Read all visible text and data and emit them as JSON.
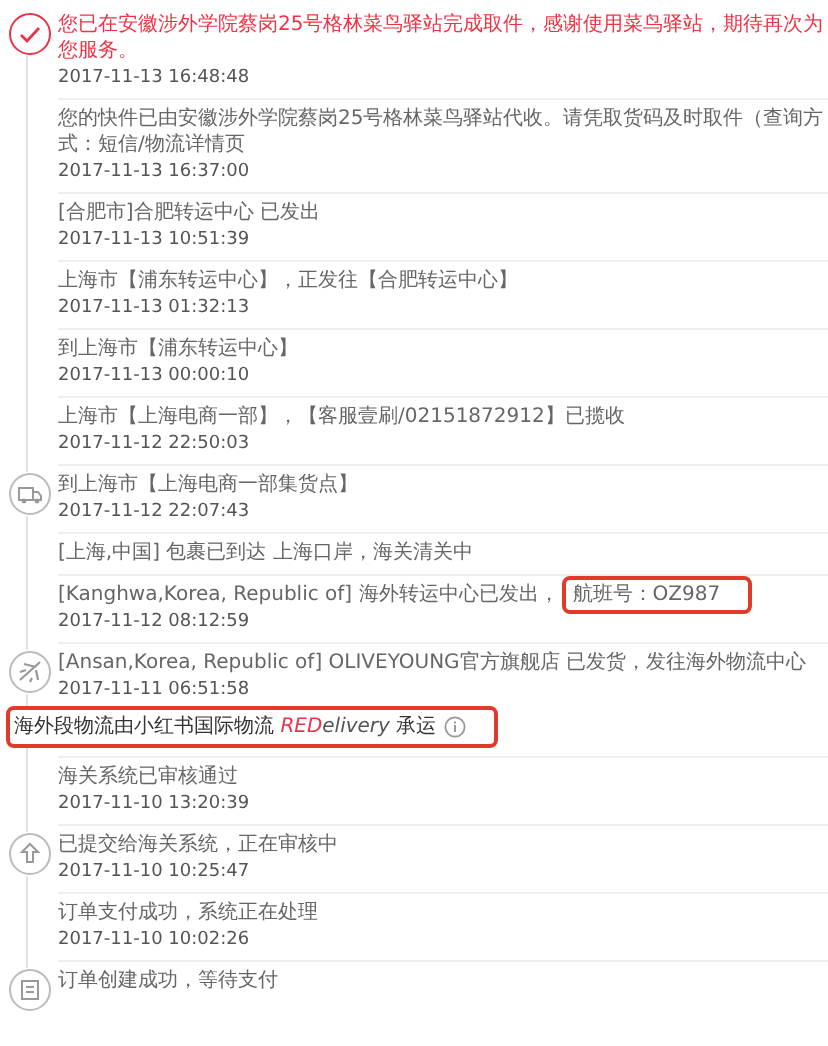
{
  "events": [
    {
      "kind": "check",
      "current": true,
      "text": "您已在安徽涉外学院蔡岗25号格林菜鸟驿站完成取件，感谢使用菜鸟驿站，期待再次为您服务。",
      "time": "2017-11-13 16:48:48"
    },
    {
      "kind": "none",
      "current": false,
      "text": "您的快件已由安徽涉外学院蔡岗25号格林菜鸟驿站代收。请凭取货码及时取件（查询方式：短信/物流详情页",
      "time": "2017-11-13 16:37:00"
    },
    {
      "kind": "none",
      "current": false,
      "text": "[合肥市]合肥转运中心 已发出",
      "time": "2017-11-13 10:51:39"
    },
    {
      "kind": "none",
      "current": false,
      "text": "上海市【浦东转运中心】，正发往【合肥转运中心】",
      "time": "2017-11-13 01:32:13"
    },
    {
      "kind": "none",
      "current": false,
      "text": "到上海市【浦东转运中心】",
      "time": "2017-11-13 00:00:10"
    },
    {
      "kind": "none",
      "current": false,
      "text": "上海市【上海电商一部】，【客服壹刷/02151872912】已揽收",
      "time": "2017-11-12 22:50:03"
    },
    {
      "kind": "truck",
      "current": false,
      "text": "到上海市【上海电商一部集货点】",
      "time": "2017-11-12 22:07:43"
    },
    {
      "kind": "none",
      "current": false,
      "text": "[上海,中国] 包裹已到达 上海口岸，海关清关中"
    },
    {
      "kind": "none",
      "current": false,
      "text": "[Kanghwa,Korea, Republic of] 海外转运中心已发出，",
      "highlight": "航班号：OZ987",
      "time": "2017-11-12 08:12:59"
    },
    {
      "kind": "plane",
      "current": false,
      "text": "[Ansan,Korea, Republic of] OLIVEYOUNG官方旗舰店 已发货，发往海外物流中心",
      "time": "2017-11-11 06:51:58",
      "note": {
        "before": "海外段物流由小红书国际物流 ",
        "brand_accent": "RED",
        "brand_rest": "elivery",
        "after": " 承运"
      }
    },
    {
      "kind": "none",
      "current": false,
      "text": "海关系统已审核通过",
      "time": "2017-11-10 13:20:39"
    },
    {
      "kind": "upload",
      "current": false,
      "text": "已提交给海关系统，正在审核中",
      "time": "2017-11-10 10:25:47"
    },
    {
      "kind": "none",
      "current": false,
      "text": "订单支付成功，系统正在处理",
      "time": "2017-11-10 10:02:26"
    },
    {
      "kind": "order",
      "current": false,
      "text": "订单创建成功，等待支付"
    }
  ]
}
